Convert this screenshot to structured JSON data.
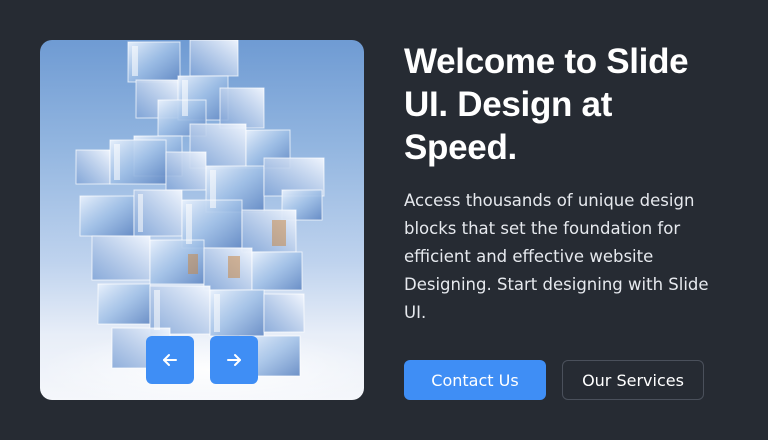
{
  "colors": {
    "background": "#262b33",
    "accent": "#3f8ef5",
    "text": "#ffffff"
  },
  "hero": {
    "image": "glass-cube-tower",
    "prev_icon": "arrow-left-icon",
    "next_icon": "arrow-right-icon"
  },
  "content": {
    "headline": "Welcome to Slide UI. Design at Speed.",
    "description": "Access thousands of unique design blocks that set the foundation for efficient and effective website Designing. Start designing with Slide UI."
  },
  "actions": {
    "contact_label": "Contact Us",
    "services_label": "Our Services"
  }
}
